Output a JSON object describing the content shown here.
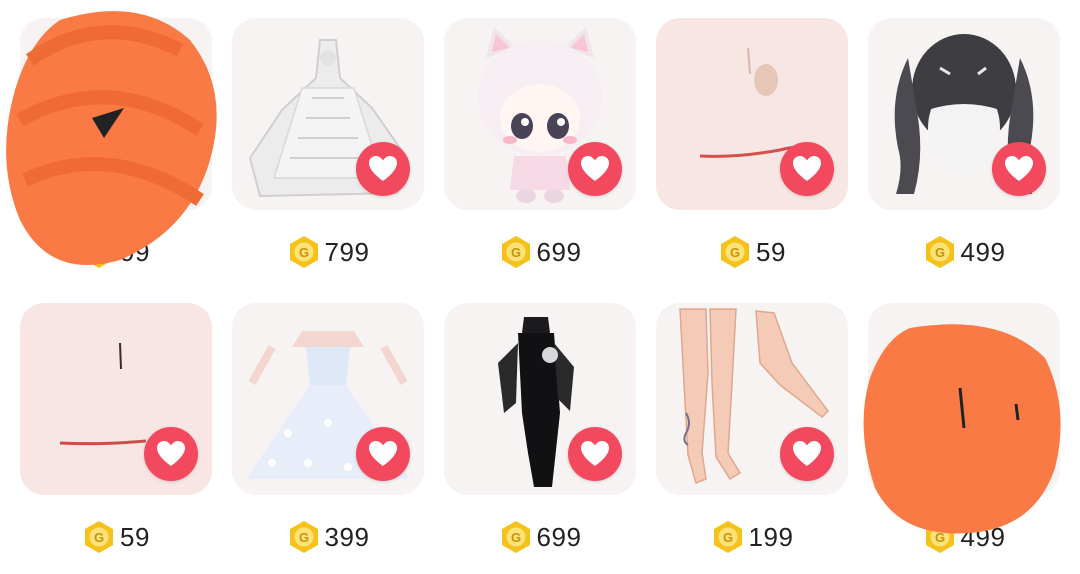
{
  "items": [
    {
      "price": "99",
      "thumb": "obscured",
      "bg": "#f7f3f2"
    },
    {
      "price": "799",
      "thumb": "white-lace-gown",
      "bg": "#f7f3f2"
    },
    {
      "price": "699",
      "thumb": "cat-ear-chibi",
      "bg": "#f7f3f2"
    },
    {
      "price": "59",
      "thumb": "face-mark",
      "bg": "#f8e6e4"
    },
    {
      "price": "499",
      "thumb": "twin-tail-hair",
      "bg": "#f7f3f2"
    },
    {
      "price": "59",
      "thumb": "face-line",
      "bg": "#f8e6e4"
    },
    {
      "price": "399",
      "thumb": "blue-ball-gown",
      "bg": "#f7f3f2"
    },
    {
      "price": "699",
      "thumb": "black-qipao",
      "bg": "#f7f3f2"
    },
    {
      "price": "199",
      "thumb": "legs-tattoo",
      "bg": "#f7f3f2"
    },
    {
      "price": "499",
      "thumb": "obscured",
      "bg": "#f7f3f2"
    }
  ],
  "colors": {
    "favorite": "#f2495f",
    "coin": "#f4c21b",
    "scribble": "#f97a45"
  },
  "icons": {
    "favorite": "heart-icon",
    "currency": "g-coin-icon"
  }
}
